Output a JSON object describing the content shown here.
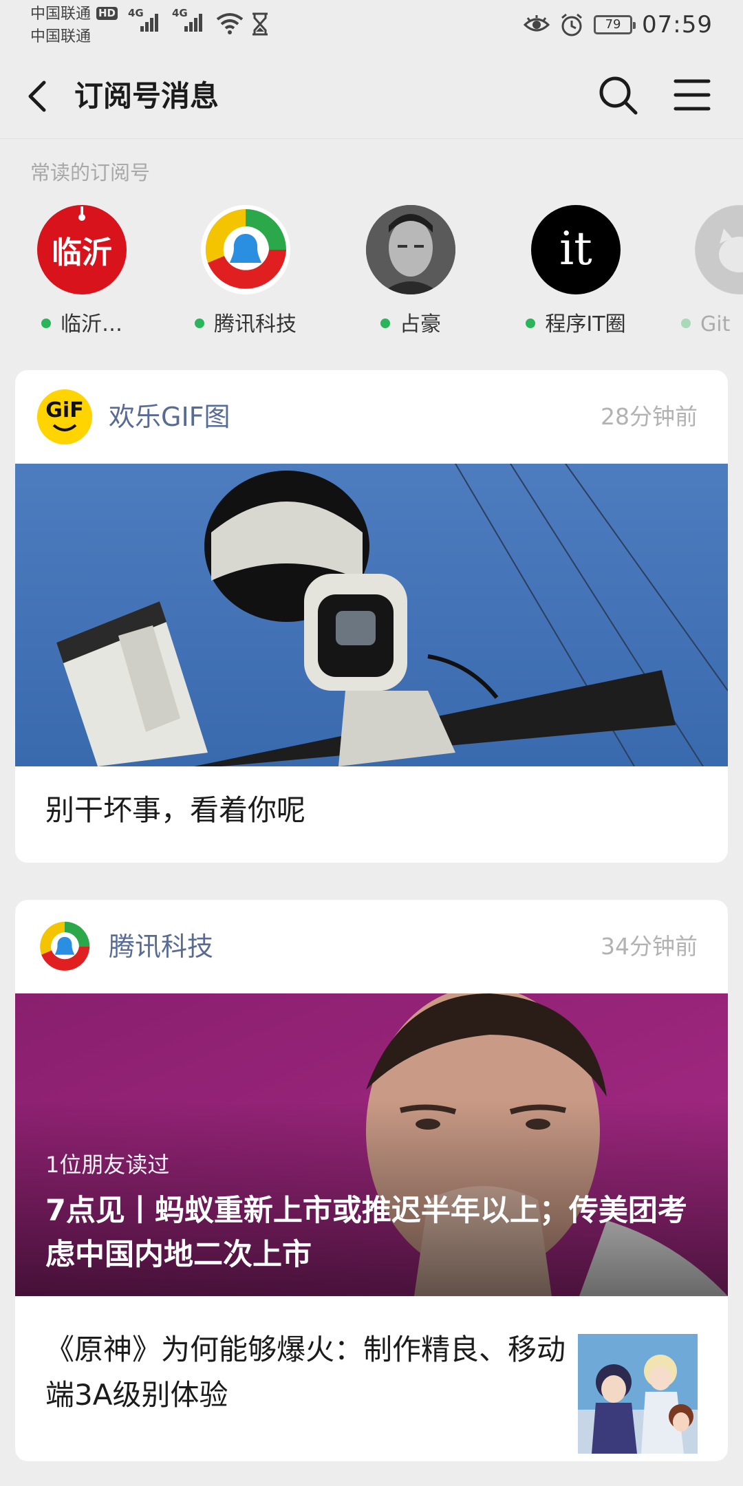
{
  "status_bar": {
    "carrier_1": "中国联通",
    "carrier_2": "中国联通",
    "hd_badge": "HD",
    "network_1": "4G",
    "network_2": "4G",
    "battery_level": "79",
    "time": "07:59"
  },
  "navbar": {
    "title": "订阅号消息"
  },
  "frequent": {
    "label": "常读的订阅号",
    "accounts": [
      {
        "name": "临沂…",
        "has_update": true
      },
      {
        "name": "腾讯科技",
        "has_update": true
      },
      {
        "name": "占豪",
        "has_update": true
      },
      {
        "name": "程序IT圈",
        "has_update": true
      },
      {
        "name": "Git",
        "has_update": true
      }
    ],
    "logo_texts": {
      "linyi": "临沂",
      "it": "it"
    }
  },
  "cards": [
    {
      "source": "欢乐GIF图",
      "logo_text": "GiF",
      "time": "28分钟前",
      "caption": "别干坏事，看着你呢"
    },
    {
      "source": "腾讯科技",
      "time": "34分钟前",
      "readers": "1位朋友读过",
      "headline": "7点见丨蚂蚁重新上市或推迟半年以上；传美团考虑中国内地二次上市",
      "sub_title": "《原神》为何能够爆火：制作精良、移动端3A级别体验"
    }
  ],
  "colors": {
    "background": "#ededed",
    "card": "#ffffff",
    "source_link": "#576b95",
    "unread_dot": "#2bb55a",
    "muted_text": "#b2b2b2"
  }
}
